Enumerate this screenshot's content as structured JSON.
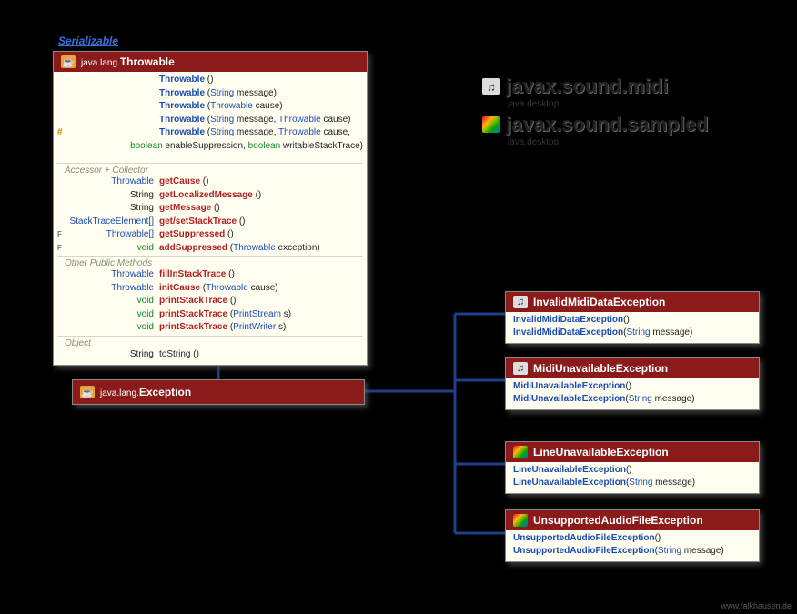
{
  "serializable_label": "Serializable",
  "throwable": {
    "package": "java.lang.",
    "class": "Throwable",
    "ctors": [
      {
        "name": "Throwable",
        "params": []
      },
      {
        "name": "Throwable",
        "params": [
          {
            "type": "String",
            "name": "message"
          }
        ]
      },
      {
        "name": "Throwable",
        "params": [
          {
            "type": "Throwable",
            "name": "cause"
          }
        ]
      },
      {
        "name": "Throwable",
        "params": [
          {
            "type": "String",
            "name": "message"
          },
          {
            "type": "Throwable",
            "name": "cause"
          }
        ]
      },
      {
        "prefix": "#",
        "name": "Throwable",
        "params": [
          {
            "type": "String",
            "name": "message"
          },
          {
            "type": "Throwable",
            "name": "cause"
          }
        ],
        "extra": [
          {
            "kw": "boolean",
            "name": "enableSuppression"
          },
          {
            "kw": "boolean",
            "name": "writableStackTrace"
          }
        ]
      }
    ],
    "section_accessor": "Accessor + Collector",
    "accessors": [
      {
        "type": "Throwable",
        "name": "getCause",
        "params": ""
      },
      {
        "type": "String",
        "name": "getLocalizedMessage",
        "params": ""
      },
      {
        "type": "String",
        "name": "getMessage",
        "params": ""
      },
      {
        "type": "StackTraceElement[]",
        "type_color": "blue",
        "name": "get/setStackTrace",
        "params": ""
      },
      {
        "prefix": "F",
        "type": "Throwable[]",
        "name": "getSuppressed",
        "params": ""
      },
      {
        "prefix": "F",
        "type": "void",
        "type_color": "green",
        "name": "addSuppressed",
        "params": "(Throwable exception)"
      }
    ],
    "section_other": "Other Public Methods",
    "others": [
      {
        "type": "Throwable",
        "name": "fillInStackTrace",
        "params": ""
      },
      {
        "type": "Throwable",
        "name": "initCause",
        "params": "(Throwable cause)"
      },
      {
        "type": "void",
        "name": "printStackTrace",
        "params": ""
      },
      {
        "type": "void",
        "name": "printStackTrace",
        "params": "(PrintStream s)"
      },
      {
        "type": "void",
        "name": "printStackTrace",
        "params": "(PrintWriter s)"
      }
    ],
    "section_object": "Object",
    "object_methods": [
      {
        "type": "String",
        "name": "toString",
        "params": ""
      }
    ]
  },
  "exception": {
    "package": "java.lang.",
    "class": "Exception"
  },
  "pkgs": {
    "midi": {
      "name": "javax.sound.midi",
      "module": "java.desktop"
    },
    "sampled": {
      "name": "javax.sound.sampled",
      "module": "java.desktop"
    }
  },
  "invalidMidi": {
    "class": "InvalidMidiDataException",
    "ctors": [
      {
        "name": "InvalidMidiDataException",
        "params": ""
      },
      {
        "name": "InvalidMidiDataException",
        "params": "(String message)"
      }
    ]
  },
  "midiUnavail": {
    "class": "MidiUnavailableException",
    "ctors": [
      {
        "name": "MidiUnavailableException",
        "params": ""
      },
      {
        "name": "MidiUnavailableException",
        "params": "(String message)"
      }
    ]
  },
  "lineUnavail": {
    "class": "LineUnavailableException",
    "ctors": [
      {
        "name": "LineUnavailableException",
        "params": ""
      },
      {
        "name": "LineUnavailableException",
        "params": "(String message)"
      }
    ]
  },
  "unsupportedAudio": {
    "class": "UnsupportedAudioFileException",
    "ctors": [
      {
        "name": "UnsupportedAudioFileException",
        "params": ""
      },
      {
        "name": "UnsupportedAudioFileException",
        "params": "(String message)"
      }
    ]
  },
  "watermark": "www.falkhausen.de"
}
